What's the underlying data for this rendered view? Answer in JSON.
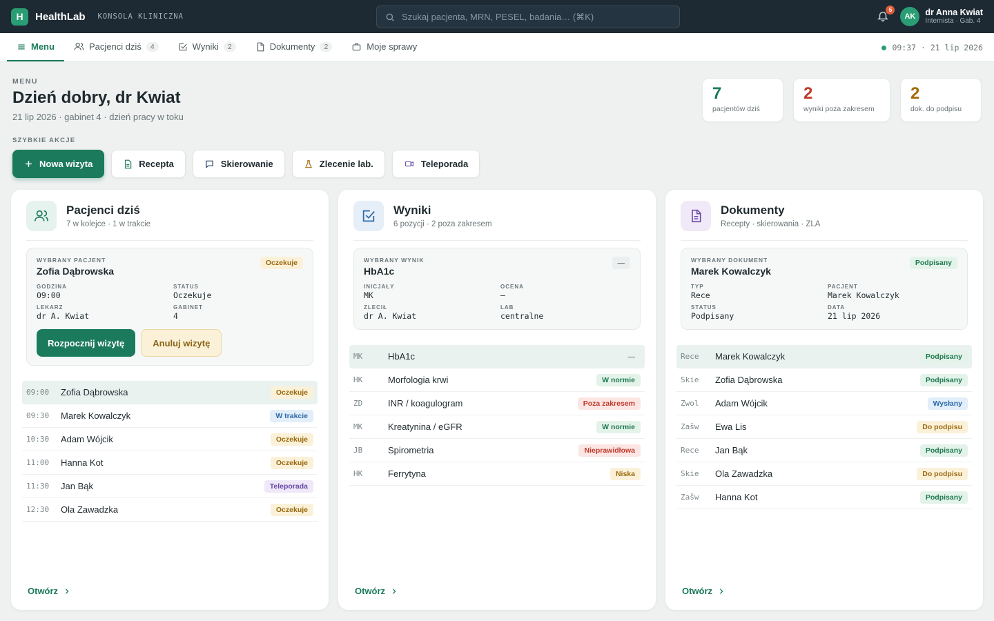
{
  "app": {
    "logo_letter": "H",
    "name": "HealthLab",
    "subtitle": "KONSOLA KLINICZNA"
  },
  "search": {
    "placeholder": "Szukaj pacjenta, MRN, PESEL, badania… (⌘K)"
  },
  "user": {
    "notifications": "5",
    "initials": "AK",
    "name": "dr Anna Kwiat",
    "role": "Internista · Gab. 4"
  },
  "tabs": [
    {
      "label": "Menu",
      "count": ""
    },
    {
      "label": "Pacjenci dziś",
      "count": "4"
    },
    {
      "label": "Wyniki",
      "count": "2"
    },
    {
      "label": "Dokumenty",
      "count": "2"
    },
    {
      "label": "Moje sprawy",
      "count": ""
    }
  ],
  "clock": "09:37 · 21 lip 2026",
  "header": {
    "eyebrow": "MENU",
    "greeting": "Dzień dobry, dr Kwiat",
    "subtitle": "21 lip 2026 · gabinet 4 · dzień pracy w toku",
    "quick_label": "SZYBKIE AKCJE"
  },
  "actions": [
    "Nowa wizyta",
    "Recepta",
    "Skierowanie",
    "Zlecenie lab.",
    "Teleporada"
  ],
  "stats": [
    {
      "value": "7",
      "label": "pacjentów dziś",
      "color": "#1b7a5c"
    },
    {
      "value": "2",
      "label": "wyniki poza zakresem",
      "color": "#c0392b"
    },
    {
      "value": "2",
      "label": "dok. do podpisu",
      "color": "#a66a0a"
    }
  ],
  "patients": {
    "title": "Pacjenci dziś",
    "subtitle": "7 w kolejce · 1 w trakcie",
    "selected": {
      "eyebrow": "WYBRANY PACJENT",
      "name": "Zofia Dąbrowska",
      "badge": "Oczekuje",
      "k1": "GODZINA",
      "v1": "09:00",
      "k2": "STATUS",
      "v2": "Oczekuje",
      "k3": "LEKARZ",
      "v3": "dr A. Kwiat",
      "k4": "GABINET",
      "v4": "4",
      "start_label": "Rozpocznij wizytę",
      "cancel_label": "Anuluj wizytę"
    },
    "rows": [
      {
        "pre": "09:00",
        "name": "Zofia Dąbrowska",
        "badge": "Oczekuje",
        "kind": "warn"
      },
      {
        "pre": "09:30",
        "name": "Marek Kowalczyk",
        "badge": "W trakcie",
        "kind": "blue"
      },
      {
        "pre": "10:30",
        "name": "Adam Wójcik",
        "badge": "Oczekuje",
        "kind": "warn"
      },
      {
        "pre": "11:00",
        "name": "Hanna Kot",
        "badge": "Oczekuje",
        "kind": "warn"
      },
      {
        "pre": "11:30",
        "name": "Jan Bąk",
        "badge": "Teleporada",
        "kind": "purple"
      },
      {
        "pre": "12:30",
        "name": "Ola Zawadzka",
        "badge": "Oczekuje",
        "kind": "warn"
      }
    ],
    "open_label": "Otwórz"
  },
  "results": {
    "title": "Wyniki",
    "subtitle": "6 pozycji · 2 poza zakresem",
    "selected": {
      "eyebrow": "WYBRANY WYNIK",
      "name": "HbA1c",
      "badge": "—",
      "k1": "INICJAŁY",
      "v1": "MK",
      "k2": "OCENA",
      "v2": "—",
      "k3": "ZLECIŁ",
      "v3": "dr A. Kwiat",
      "k4": "LAB",
      "v4": "centralne"
    },
    "rows": [
      {
        "pre": "MK",
        "name": "HbA1c",
        "badge": "—",
        "kind": "none"
      },
      {
        "pre": "HK",
        "name": "Morfologia krwi",
        "badge": "W normie",
        "kind": "green"
      },
      {
        "pre": "ZD",
        "name": "INR / koagulogram",
        "badge": "Poza zakresem",
        "kind": "red"
      },
      {
        "pre": "MK",
        "name": "Kreatynina / eGFR",
        "badge": "W normie",
        "kind": "green"
      },
      {
        "pre": "JB",
        "name": "Spirometria",
        "badge": "Nieprawidłowa",
        "kind": "red"
      },
      {
        "pre": "HK",
        "name": "Ferrytyna",
        "badge": "Niska",
        "kind": "warn"
      }
    ],
    "open_label": "Otwórz"
  },
  "documents": {
    "title": "Dokumenty",
    "subtitle": "Recepty · skierowania · ZLA",
    "selected": {
      "eyebrow": "WYBRANY DOKUMENT",
      "name": "Marek Kowalczyk",
      "badge": "Podpisany",
      "k1": "TYP",
      "v1": "Rece",
      "k2": "PACJENT",
      "v2": "Marek Kowalczyk",
      "k3": "STATUS",
      "v3": "Podpisany",
      "k4": "DATA",
      "v4": "21 lip 2026"
    },
    "rows": [
      {
        "pre": "Rece",
        "name": "Marek Kowalczyk",
        "badge": "Podpisany",
        "kind": "green"
      },
      {
        "pre": "Skie",
        "name": "Zofia Dąbrowska",
        "badge": "Podpisany",
        "kind": "green"
      },
      {
        "pre": "Zwol",
        "name": "Adam Wójcik",
        "badge": "Wysłany",
        "kind": "blue"
      },
      {
        "pre": "Zašw",
        "name": "Ewa Lis",
        "badge": "Do podpisu",
        "kind": "warn"
      },
      {
        "pre": "Rece",
        "name": "Jan Bąk",
        "badge": "Podpisany",
        "kind": "green"
      },
      {
        "pre": "Skie",
        "name": "Ola Zawadzka",
        "badge": "Do podpisu",
        "kind": "warn"
      },
      {
        "pre": "Zašw",
        "name": "Hanna Kot",
        "badge": "Podpisany",
        "kind": "green"
      }
    ],
    "open_label": "Otwórz"
  },
  "icons": {
    "search": "search-icon",
    "bell": "bell-icon",
    "menu": "menu-icon",
    "users": "users-icon",
    "check": "check-square-icon",
    "doc": "document-icon",
    "briefcase": "briefcase-icon",
    "plus": "plus-icon",
    "flask": "flask-icon",
    "video": "video-icon",
    "chat": "chat-icon",
    "chevron": "chevron-right-icon"
  }
}
